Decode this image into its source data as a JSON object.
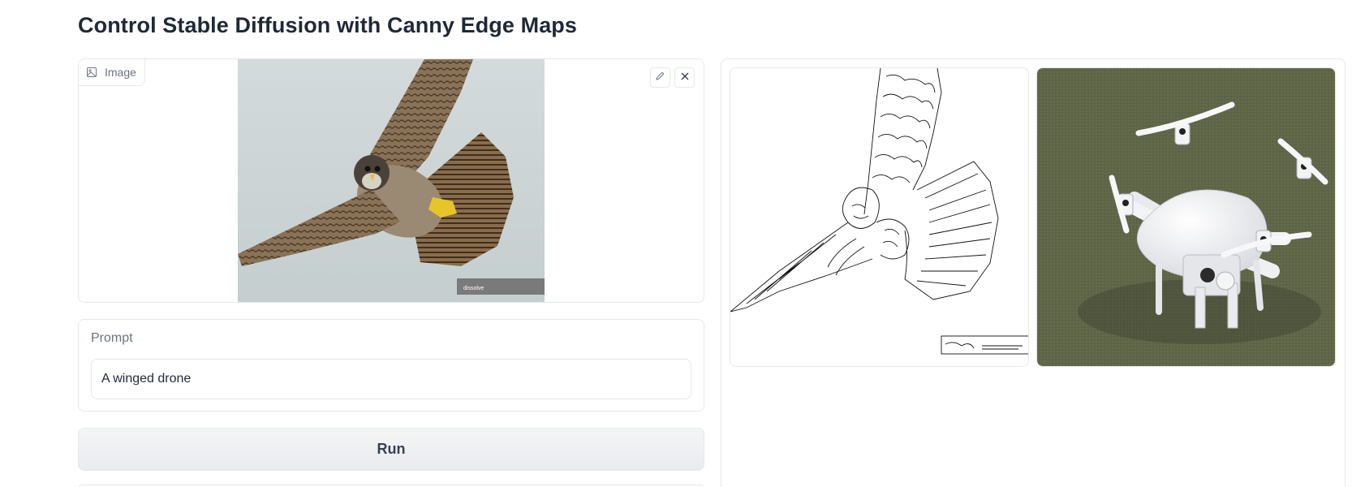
{
  "page": {
    "title": "Control Stable Diffusion with Canny Edge Maps"
  },
  "image_input": {
    "label": "Image",
    "icon": "image-icon",
    "edit_icon": "pencil-icon",
    "clear_icon": "close-icon",
    "watermark": "dissolve"
  },
  "prompt": {
    "label": "Prompt",
    "value": "A winged drone"
  },
  "run_button": {
    "label": "Run"
  },
  "gallery": {
    "items": [
      {
        "kind": "canny-edge-map"
      },
      {
        "kind": "generated-image"
      }
    ]
  },
  "colors": {
    "border": "#e5e7eb",
    "muted_text": "#6b7280",
    "title_text": "#1f2937",
    "button_bg": "#eceef1"
  }
}
